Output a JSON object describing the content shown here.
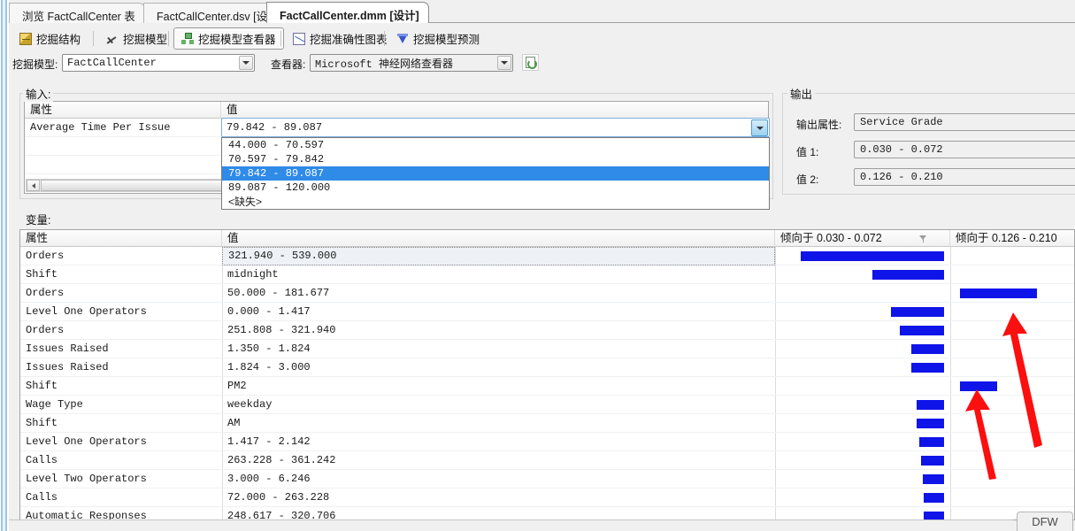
{
  "window": {
    "document_tabs": [
      {
        "label": "浏览 FactCallCenter 表",
        "selected": false
      },
      {
        "label": "FactCallCenter.dsv [设计]",
        "selected": false
      },
      {
        "label": "FactCallCenter.dmm [设计]",
        "selected": true
      }
    ],
    "status_badge": "DFW"
  },
  "designer_tabs": [
    {
      "label": "挖掘结构",
      "icon": "mining-structure-icon",
      "active": false
    },
    {
      "label": "挖掘模型",
      "icon": "mining-model-icon",
      "active": false
    },
    {
      "label": "挖掘模型查看器",
      "icon": "mining-model-viewer-icon",
      "active": true
    },
    {
      "label": "挖掘准确性图表",
      "icon": "accuracy-chart-icon",
      "active": false
    },
    {
      "label": "挖掘模型预测",
      "icon": "model-prediction-icon",
      "active": false
    }
  ],
  "toolbar": {
    "mining_model_label": "挖掘模型:",
    "mining_model_value": "FactCallCenter",
    "viewer_label": "查看器:",
    "viewer_value": "Microsoft 神经网络查看器",
    "refresh_icon": "refresh-viewer-icon"
  },
  "input_panel": {
    "title": "输入:",
    "columns": [
      "属性",
      "值"
    ],
    "rows": [
      {
        "attribute": "Average Time Per Issue",
        "value": "79.842 - 89.087"
      }
    ],
    "dropdown_open": true,
    "dropdown_options": [
      {
        "label": "44.000 - 70.597",
        "highlighted": false
      },
      {
        "label": "70.597 - 79.842",
        "highlighted": false
      },
      {
        "label": "79.842 - 89.087",
        "highlighted": true
      },
      {
        "label": "89.087 - 120.000",
        "highlighted": false
      },
      {
        "label": "<缺失>",
        "highlighted": false
      }
    ]
  },
  "output_panel": {
    "title": "输出",
    "output_attribute_label": "输出属性:",
    "output_attribute_value": "Service Grade",
    "value1_label": "值 1:",
    "value1_value": "0.030 - 0.072",
    "value2_label": "值 2:",
    "value2_value": "0.126 - 0.210"
  },
  "variables_panel": {
    "title": "变量:",
    "columns": {
      "attribute": "属性",
      "value": "值",
      "favors1": "倾向于 0.030 - 0.072",
      "favors2": "倾向于 0.126 - 0.210"
    },
    "filter_icon": "filter-icon",
    "bar_color": "#0f14e8"
  },
  "chart_data": {
    "type": "bar",
    "title": "倾向于 0.030 - 0.072 / 倾向于 0.126 - 0.210",
    "xlabel": "",
    "ylabel": "",
    "legend": [
      "倾向于 0.030 - 0.072",
      "倾向于 0.126 - 0.210"
    ],
    "categories": [
      "Orders",
      "Shift",
      "Orders",
      "Level One Operators",
      "Orders",
      "Issues Raised",
      "Issues Raised",
      "Shift",
      "Wage Type",
      "Shift",
      "Level One Operators",
      "Calls",
      "Level Two Operators",
      "Calls",
      "Automatic Responses"
    ],
    "rows": [
      {
        "attribute": "Orders",
        "value": "321.940 - 539.000",
        "favors1": 100,
        "favors2": 0,
        "selected": true
      },
      {
        "attribute": "Shift",
        "value": "midnight",
        "favors1": 50,
        "favors2": 0
      },
      {
        "attribute": "Orders",
        "value": "50.000 - 181.677",
        "favors1": 0,
        "favors2": 46
      },
      {
        "attribute": "Level One Operators",
        "value": "0.000 - 1.417",
        "favors1": 37,
        "favors2": 0
      },
      {
        "attribute": "Orders",
        "value": "251.808 - 321.940",
        "favors1": 31,
        "favors2": 0
      },
      {
        "attribute": "Issues Raised",
        "value": "1.350 - 1.824",
        "favors1": 23,
        "favors2": 0
      },
      {
        "attribute": "Issues Raised",
        "value": "1.824 - 3.000",
        "favors1": 23,
        "favors2": 0
      },
      {
        "attribute": "Shift",
        "value": "PM2",
        "favors1": 0,
        "favors2": 22
      },
      {
        "attribute": "Wage Type",
        "value": "weekday",
        "favors1": 19,
        "favors2": 0
      },
      {
        "attribute": "Shift",
        "value": "AM",
        "favors1": 19,
        "favors2": 0
      },
      {
        "attribute": "Level One Operators",
        "value": "1.417 - 2.142",
        "favors1": 17,
        "favors2": 0
      },
      {
        "attribute": "Calls",
        "value": "263.228 - 361.242",
        "favors1": 16,
        "favors2": 0
      },
      {
        "attribute": "Level Two Operators",
        "value": "3.000 - 6.246",
        "favors1": 15,
        "favors2": 0
      },
      {
        "attribute": "Calls",
        "value": "72.000 - 263.228",
        "favors1": 14,
        "favors2": 0
      },
      {
        "attribute": "Automatic Responses",
        "value": "248.617 - 320.706",
        "favors1": 14,
        "favors2": 0
      }
    ],
    "axis_note": "Bars in column 1 are right-aligned toward the center axis; bars in column 2 are left-aligned from the center axis.",
    "grid": false,
    "legend_position": "column-headers"
  },
  "annotations": [
    {
      "name": "red-arrow-lower",
      "from": [
        1125,
        540
      ],
      "to": [
        1104,
        450
      ]
    },
    {
      "name": "red-arrow-upper",
      "from": [
        1175,
        500
      ],
      "to": [
        1143,
        358
      ]
    }
  ]
}
